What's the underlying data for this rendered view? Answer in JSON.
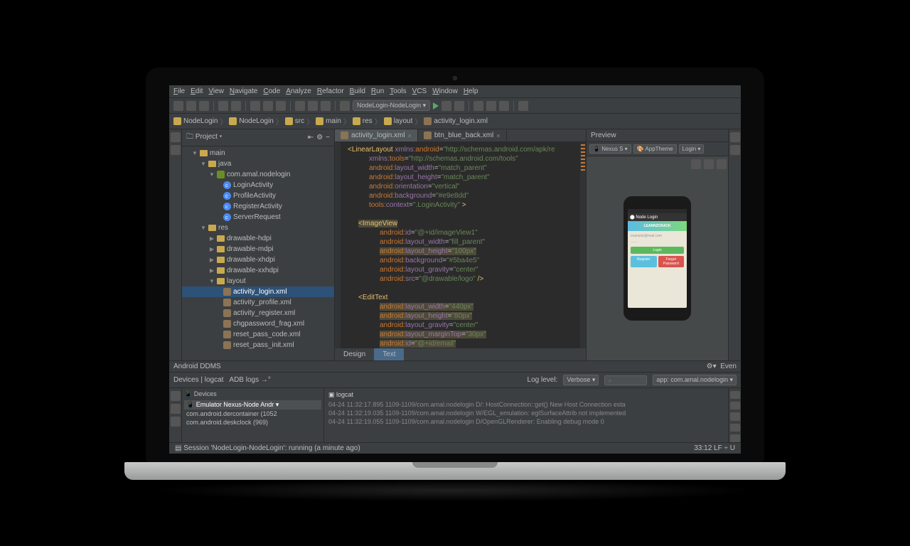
{
  "menu": {
    "file": "File",
    "edit": "Edit",
    "view": "View",
    "navigate": "Navigate",
    "code": "Code",
    "analyze": "Analyze",
    "refactor": "Refactor",
    "build": "Build",
    "run": "Run",
    "tools": "Tools",
    "vcs": "VCS",
    "window": "Window",
    "help": "Help"
  },
  "toolbar": {
    "config": "NodeLogin-NodeLogin ▾"
  },
  "breadcrumb": {
    "b0": "NodeLogin",
    "b1": "NodeLogin",
    "b2": "src",
    "b3": "main",
    "b4": "res",
    "b5": "layout",
    "b6": "activity_login.xml"
  },
  "project": {
    "title": "Project",
    "tree": {
      "main": "main",
      "java": "java",
      "pkg": "com.amal.nodelogin",
      "c0": "LoginActivity",
      "c1": "ProfileActivity",
      "c2": "RegisterActivity",
      "c3": "ServerRequest",
      "res": "res",
      "d0": "drawable-hdpi",
      "d1": "drawable-mdpi",
      "d2": "drawable-xhdpi",
      "d3": "drawable-xxhdpi",
      "layout": "layout",
      "x0": "activity_login.xml",
      "x1": "activity_profile.xml",
      "x2": "activity_register.xml",
      "x3": "chgpassword_frag.xml",
      "x4": "reset_pass_code.xml",
      "x5": "reset_pass_init.xml"
    }
  },
  "tabs": {
    "t0": "activity_login.xml",
    "t1": "btn_blue_back.xml"
  },
  "code": {
    "l0a": "<LinearLayout",
    "l0b": "xmlns:",
    "l0c": "android",
    "l0d": "=",
    "l0e": "\"http://schemas.android.com/apk/re",
    "l1a": "xmlns:",
    "l1b": "tools",
    "l1c": "=",
    "l1d": "\"http://schemas.android.com/tools\"",
    "l2a": "android:",
    "l2b": "layout_width",
    "l2c": "=",
    "l2d": "\"match_parent\"",
    "l3a": "android:",
    "l3b": "layout_height",
    "l3c": "=",
    "l3d": "\"match_parent\"",
    "l4a": "android:",
    "l4b": "orientation",
    "l4c": "=",
    "l4d": "\"vertical\"",
    "l5a": "android:",
    "l5b": "background",
    "l5c": "=",
    "l5d": "\"#e9e8dd\"",
    "l6a": "tools:",
    "l6b": "context",
    "l6c": "=",
    "l6d": "\".LoginActivity\"",
    "l6e": " >",
    "l7a": "<ImageView",
    "l8a": "android:",
    "l8b": "id",
    "l8c": "=",
    "l8d": "\"@+id/imageView1\"",
    "l9a": "android:",
    "l9b": "layout_width",
    "l9c": "=",
    "l9d": "\"fill_parent\"",
    "l10a": "android:",
    "l10b": "layout_height",
    "l10c": "=",
    "l10d": "\"100px\"",
    "l11a": "android:",
    "l11b": "background",
    "l11c": "=",
    "l11d": "\"#5ba4e5\"",
    "l12a": "android:",
    "l12b": "layout_gravity",
    "l12c": "=",
    "l12d": "\"center\"",
    "l13a": "android:",
    "l13b": "src",
    "l13c": "=",
    "l13d": "\"@drawable/logo\"",
    "l13e": " />",
    "l14a": "<EditText",
    "l15a": "android:",
    "l15b": "layout_width",
    "l15c": "=",
    "l15d": "\"440px\"",
    "l16a": "android:",
    "l16b": "layout_height",
    "l16c": "=",
    "l16d": "\"80px\"",
    "l17a": "android:",
    "l17b": "layout_gravity",
    "l17c": "=",
    "l17d": "\"center\"",
    "l18a": "android:",
    "l18b": "layout_marginTop",
    "l18c": "=",
    "l18d": "\"30px\"",
    "l19a": "android:",
    "l19b": "id",
    "l19c": "=",
    "l19d": "\"@+id/email\""
  },
  "designTabs": {
    "design": "Design",
    "text": "Text"
  },
  "preview": {
    "title": "Preview",
    "device": "Nexus S ▾",
    "theme": "AppTheme",
    "variant": "Login ▾",
    "phone": {
      "title": "Node Login",
      "banner": "LEARN2CRACK",
      "email": "example@mail.com",
      "pass": "······",
      "login": "Login",
      "register": "Register",
      "forgot": "Forgot Password"
    }
  },
  "ddms": {
    "title": "Android DDMS",
    "devtab": "Devices | logcat",
    "adb": "ADB logs",
    "loglevel": "Log level:",
    "verbose": "Verbose ▾",
    "app": "app: com.amal.nodelogin ▾",
    "devices": "Devices",
    "logcat": "logcat",
    "dev0": "Emulator Nexus-Node Andr ▾",
    "dev1": "com.android.dercontainer (1052",
    "dev2": "com.android.deskclock (969)",
    "log0": "04-24 11:32:17.895    1109-1109/com.amal.nodelogin D/: HostConnection::get() New Host Connection esta",
    "log1": "04-24 11:32:19.035    1109-1109/com.amal.nodelogin W/EGL_emulation: eglSurfaceAttrib not implemented",
    "log2": "04-24 11:32:19.055    1109-1109/com.amal.nodelogin D/OpenGLRenderer: Enabling debug mode 0"
  },
  "status": {
    "left": "Session 'NodeLogin-NodeLogin': running (a minute ago)",
    "right": "33:12  LF ÷  U"
  },
  "events": "Even"
}
